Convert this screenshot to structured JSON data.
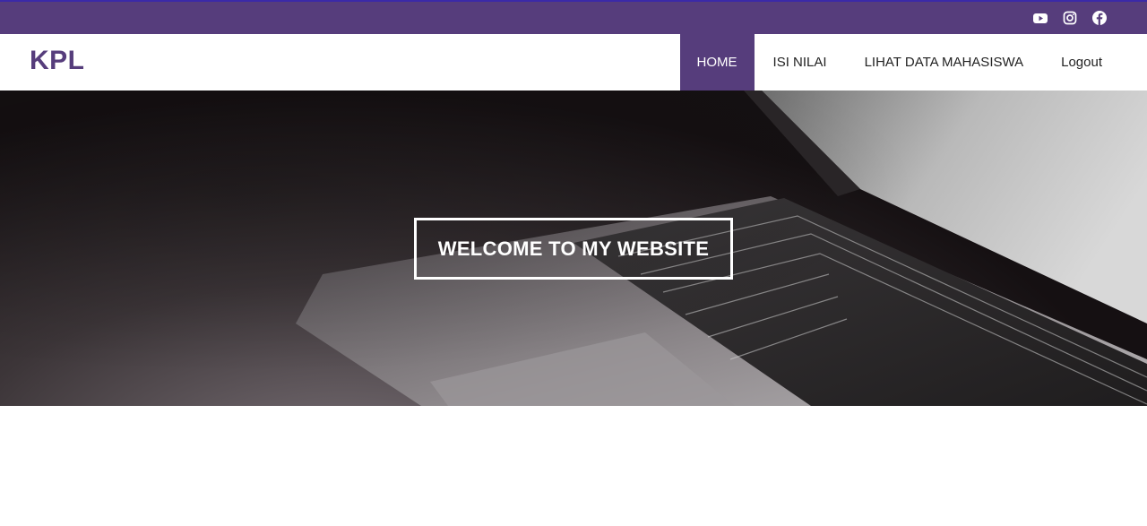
{
  "topbar": {
    "social_icons": [
      "youtube-icon",
      "instagram-icon",
      "facebook-icon"
    ],
    "background_color": "#563d7c"
  },
  "navbar": {
    "brand": "KPL",
    "menu": [
      {
        "label": "HOME",
        "active": true
      },
      {
        "label": "ISI NILAI",
        "active": false
      },
      {
        "label": "LIHAT DATA MAHASISWA",
        "active": false
      },
      {
        "label": "Logout",
        "active": false
      }
    ],
    "accent_color": "#563d7c"
  },
  "hero": {
    "title": "WELCOME TO MY WEBSITE"
  }
}
